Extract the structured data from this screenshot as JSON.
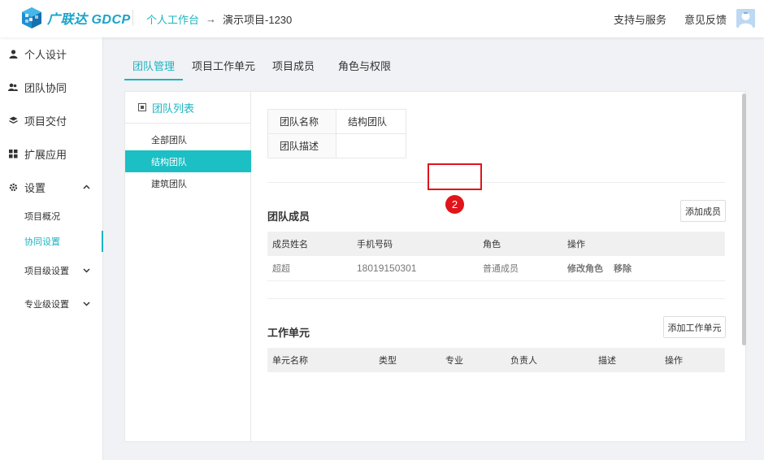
{
  "header": {
    "logo_text": "广联达 GDCP",
    "breadcrumb_home": "个人工作台",
    "breadcrumb_arrow": "→",
    "breadcrumb_current": "演示项目-1230",
    "support_link": "支持与服务",
    "feedback_link": "意见反馈"
  },
  "sidebar": {
    "items": [
      {
        "label": "个人设计",
        "icon": "person-icon"
      },
      {
        "label": "团队协同",
        "icon": "team-icon"
      },
      {
        "label": "项目交付",
        "icon": "layers-icon"
      },
      {
        "label": "扩展应用",
        "icon": "grid-icon"
      },
      {
        "label": "设置",
        "icon": "gear-icon"
      }
    ],
    "sub_items": [
      {
        "label": "项目概况"
      },
      {
        "label": "协同设置",
        "active": true
      },
      {
        "label": "项目级设置"
      },
      {
        "label": "专业级设置"
      }
    ]
  },
  "tabs": [
    {
      "label": "团队管理",
      "active": true
    },
    {
      "label": "项目工作单元"
    },
    {
      "label": "项目成员"
    },
    {
      "label": "角色与权限"
    }
  ],
  "team_list": {
    "title": "团队列表",
    "items": [
      {
        "label": "全部团队"
      },
      {
        "label": "结构团队",
        "active": true
      },
      {
        "label": "建筑团队"
      }
    ]
  },
  "team_info": {
    "name_label": "团队名称",
    "name_value": "结构团队",
    "desc_label": "团队描述",
    "desc_value": ""
  },
  "members": {
    "title": "团队成员",
    "add_button": "添加成员",
    "columns": [
      "成员姓名",
      "手机号码",
      "角色",
      "操作"
    ],
    "rows": [
      {
        "name": "超超",
        "phone": "18019150301",
        "role": "普通成员",
        "action_edit": "修改角色",
        "action_remove": "移除"
      }
    ]
  },
  "work_units": {
    "title": "工作单元",
    "add_button": "添加工作单元",
    "columns": [
      "单元名称",
      "类型",
      "专业",
      "负责人",
      "描述",
      "操作"
    ]
  },
  "annotation": {
    "badge": "2",
    "color": "#e0141a"
  },
  "colors": {
    "accent": "#1bb4c2",
    "active_bg": "#1bbfc4"
  }
}
